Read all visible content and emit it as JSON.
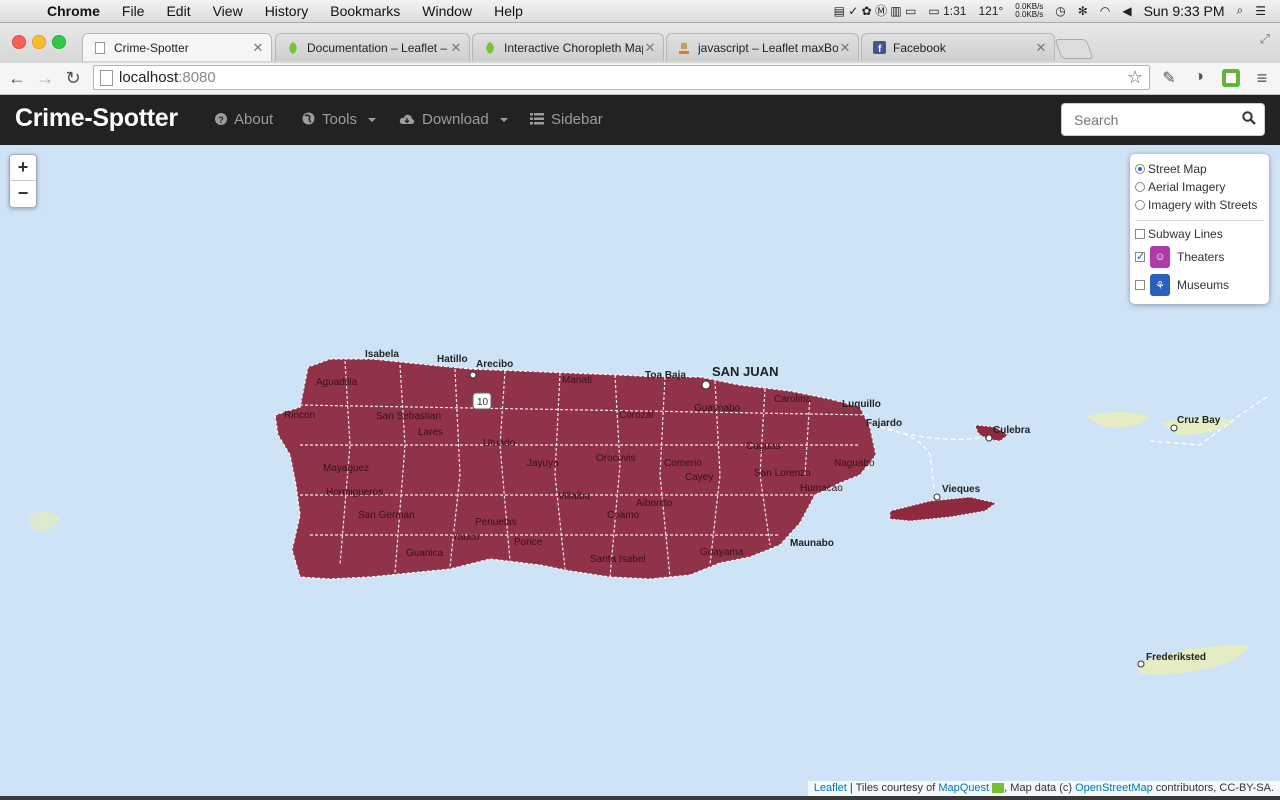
{
  "menubar": {
    "app": "Chrome",
    "items": [
      "File",
      "Edit",
      "View",
      "History",
      "Bookmarks",
      "Window",
      "Help"
    ],
    "battery_time": "1:31",
    "temperature": "121°",
    "net_up": "0.0KB/s",
    "net_down": "0.0KB/s",
    "clock": "Sun 9:33 PM"
  },
  "tabs": [
    {
      "title": "Crime-Spotter",
      "active": true,
      "favicon": "page-icon"
    },
    {
      "title": "Documentation – Leaflet –",
      "active": false,
      "favicon": "leaflet-icon"
    },
    {
      "title": "Interactive Choropleth Map",
      "active": false,
      "favicon": "leaflet-icon"
    },
    {
      "title": "javascript – Leaflet maxBo",
      "active": false,
      "favicon": "stackoverflow-icon"
    },
    {
      "title": "Facebook",
      "active": false,
      "favicon": "facebook-icon"
    }
  ],
  "toolbar": {
    "url_host": "localhost",
    "url_port": ":8080"
  },
  "navbar": {
    "brand": "Crime-Spotter",
    "about": "About",
    "tools": "Tools",
    "download": "Download",
    "sidebar": "Sidebar",
    "search_placeholder": "Search"
  },
  "layers": {
    "base": [
      {
        "label": "Street Map",
        "checked": true
      },
      {
        "label": "Aerial Imagery",
        "checked": false
      },
      {
        "label": "Imagery with Streets",
        "checked": false
      }
    ],
    "overlays": [
      {
        "label": "Subway Lines",
        "checked": false
      },
      {
        "label": "Theaters",
        "checked": true
      },
      {
        "label": "Museums",
        "checked": false
      }
    ]
  },
  "map_labels": {
    "san_juan": "SAN JUAN",
    "isabela": "Isabela",
    "hatillo": "Hatillo",
    "arecibo": "Arecibo",
    "toa_baja": "Toa Baja",
    "luquillo": "Luquillo",
    "fajardo": "Fajardo",
    "culebra": "Culebra",
    "vieques": "Vieques",
    "cruz_bay": "Cruz Bay",
    "frederiksted": "Frederiksted",
    "aguadilla": "Aguadilla",
    "rincon": "Rincon",
    "mayaguez": "Mayaguez",
    "san_sebastian": "San Sebastian",
    "lares": "Lares",
    "utuado": "Utuado",
    "manati": "Manati",
    "san_german": "San German",
    "hormigueros": "Hormigueros",
    "yauco": "Yauco",
    "guanica": "Guanica",
    "penuelas": "Penuelas",
    "ponce": "Ponce",
    "villalba": "Villalba",
    "coamo": "Coamo",
    "santa_isabel": "Santa Isabel",
    "guayama": "Guayama",
    "maunabo": "Maunabo",
    "humacao": "Humacao",
    "caguas": "Caguas",
    "cayey": "Cayey",
    "guaynabo": "Guaynabo",
    "jayuya": "Jayuya",
    "orocovis": "Orocovis",
    "barranquitas": "Barranquitas",
    "comerio": "Comerio",
    "san_lorenzo": "San Lorenzo",
    "naguabo": "Naguabo",
    "carolina": "Carolina",
    "corozal": "Corozal",
    "aibonito": "Aibonito",
    "highway_10": "10"
  },
  "attribution": {
    "leaflet": "Leaflet",
    "tiles_text": " | Tiles courtesy of ",
    "mapquest": "MapQuest",
    "data_text": ", Map data (c) ",
    "osm": "OpenStreetMap",
    "license_text": " contributors, CC-BY-SA."
  },
  "colors": {
    "choropleth_fill": "#8e2a3f",
    "sea": "#cfe3f7",
    "navbar": "#222222",
    "theaters_marker": "#b03aa8",
    "museums_marker": "#2b5fbf"
  }
}
